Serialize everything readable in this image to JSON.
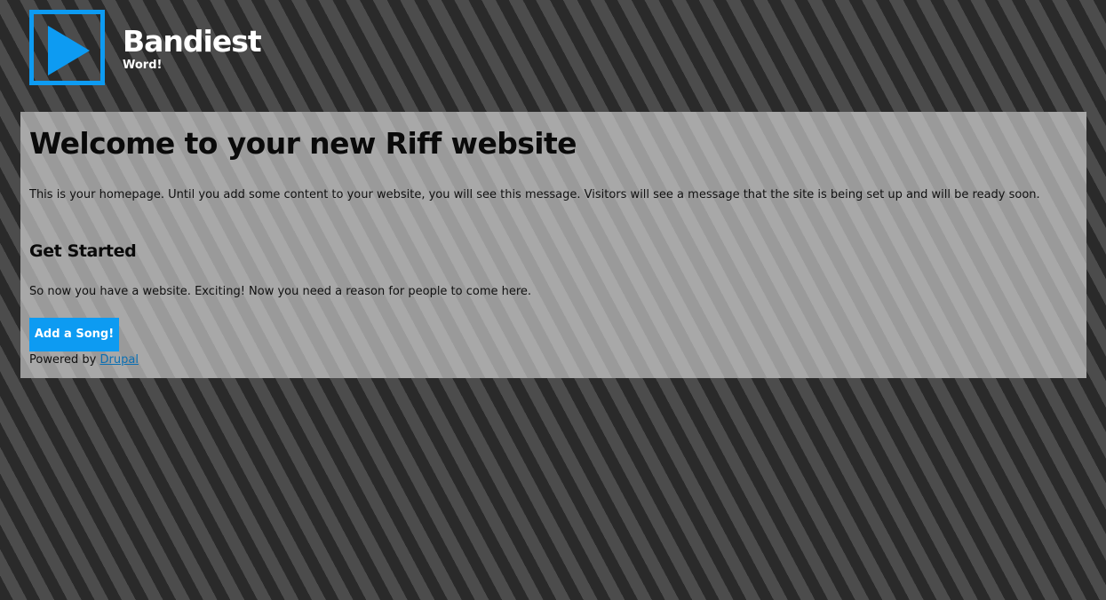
{
  "branding": {
    "logo_icon": "play-icon",
    "site_name": "Bandiest",
    "slogan": "Word!"
  },
  "main": {
    "title": "Welcome to your new Riff website",
    "intro": "This is your homepage. Until you add some content to your website, you will see this message. Visitors will see a message that the site is being set up and will be ready soon.",
    "subtitle": "Get Started",
    "body": "So now you have a website. Exciting! Now you need a reason for people to come here.",
    "button_label": "Add a Song!",
    "powered_prefix": "Powered by",
    "powered_link": "Drupal"
  },
  "colors": {
    "accent": "#0d9bf2",
    "page_background": "#2a2a2a",
    "content_background": "#9d9d9d"
  }
}
